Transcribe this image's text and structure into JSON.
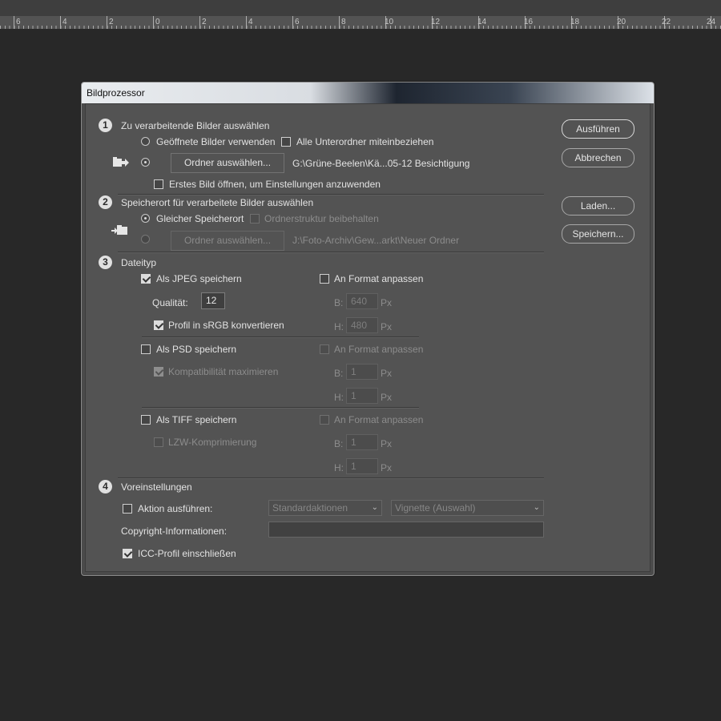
{
  "ruler": {
    "labels": [
      "6",
      "4",
      "2",
      "0",
      "2",
      "4",
      "6",
      "8",
      "10",
      "12",
      "14",
      "16",
      "18",
      "20",
      "22",
      "24"
    ]
  },
  "dialog": {
    "title": "Bildprozessor",
    "section1": {
      "number": "1",
      "heading": "Zu verarbeitende Bilder auswählen",
      "open_images_label": "Geöffnete Bilder verwenden",
      "include_subfolders_label": "Alle Unterordner miteinbeziehen",
      "choose_folder_button": "Ordner auswählen...",
      "folder_path": "G:\\Grüne-Beelen\\Kä...05-12 Besichtigung",
      "open_first_image_label": "Erstes Bild öffnen, um Einstellungen anzuwenden",
      "folder_icon": "folder-arrow-icon"
    },
    "section2": {
      "number": "2",
      "heading": "Speicherort für verarbeitete Bilder auswählen",
      "same_location_label": "Gleicher Speicherort",
      "keep_structure_label": "Ordnerstruktur beibehalten",
      "choose_folder_button": "Ordner auswählen...",
      "folder_path": "J:\\Foto-Archiv\\Gew...arkt\\Neuer Ordner",
      "folder_icon": "folder-save-icon"
    },
    "section3": {
      "number": "3",
      "heading": "Dateityp",
      "jpeg": {
        "label": "Als JPEG speichern",
        "quality_label": "Qualität:",
        "quality_value": "12",
        "srgb_label": "Profil in sRGB konvertieren",
        "fit_label": "An Format anpassen",
        "w_label": "B:",
        "w_value": "640",
        "h_label": "H:",
        "h_value": "480",
        "unit": "Px"
      },
      "psd": {
        "label": "Als PSD speichern",
        "compat_label": "Kompatibilität maximieren",
        "fit_label": "An Format anpassen",
        "w_label": "B:",
        "w_value": "1",
        "h_label": "H:",
        "h_value": "1",
        "unit": "Px"
      },
      "tiff": {
        "label": "Als TIFF speichern",
        "lzw_label": "LZW-Komprimierung",
        "fit_label": "An Format anpassen",
        "w_label": "B:",
        "w_value": "1",
        "h_label": "H:",
        "h_value": "1",
        "unit": "Px"
      }
    },
    "section4": {
      "number": "4",
      "heading": "Voreinstellungen",
      "run_action_label": "Aktion ausführen:",
      "action_set": "Standardaktionen",
      "action": "Vignette (Auswahl)",
      "copyright_label": "Copyright-Informationen:",
      "copyright_value": "",
      "icc_label": "ICC-Profil einschließen"
    },
    "buttons": {
      "run": "Ausführen",
      "cancel": "Abbrechen",
      "load": "Laden...",
      "save": "Speichern..."
    }
  }
}
